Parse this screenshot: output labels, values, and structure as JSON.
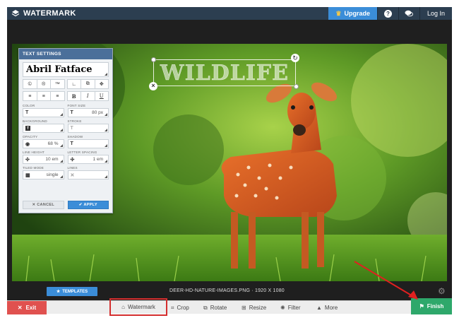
{
  "header": {
    "brand": "WATERMARK",
    "upgrade_label": "Upgrade",
    "help_label": "?",
    "login_label": "Log In"
  },
  "watermark_text": "WILDLIFE",
  "panel": {
    "title": "TEXT SETTINGS",
    "font_name": "Abril Fatface",
    "symbol_buttons": [
      "©",
      "®",
      "™"
    ],
    "bold_label": "B",
    "italic_label": "I",
    "underline_label": "U",
    "color_label": "COLOR",
    "font_size_label": "FONT SIZE",
    "font_size_value": "80 px",
    "background_label": "BACKGROUND",
    "stroke_label": "STROKE",
    "opacity_label": "OPACITY",
    "opacity_value": "68 %",
    "shadow_label": "SHADOW",
    "line_height_label": "LINE HEIGHT",
    "line_height_value": "10 em",
    "letter_spacing_label": "LETTER SPACING",
    "letter_spacing_value": "1 em",
    "tiled_mode_label": "TILED MODE",
    "tiled_mode_value": "single",
    "lines_label": "LINES",
    "cancel_label": "CANCEL",
    "apply_label": "APPLY"
  },
  "templates_label": "TEMPLATES",
  "filename": "DEER-HD-NATURE-IMAGES.PNG · 1920 X 1080",
  "toolbar": {
    "exit_label": "Exit",
    "watermark_label": "Watermark",
    "crop_label": "Crop",
    "rotate_label": "Rotate",
    "resize_label": "Resize",
    "filter_label": "Filter",
    "more_label": "More",
    "finish_label": "Finish"
  },
  "colors": {
    "header_bg": "#2c3e50",
    "accent_blue": "#3b8dd8",
    "exit_red": "#e0514f",
    "finish_green": "#2ea86b",
    "highlight_red": "#d42e2e"
  }
}
